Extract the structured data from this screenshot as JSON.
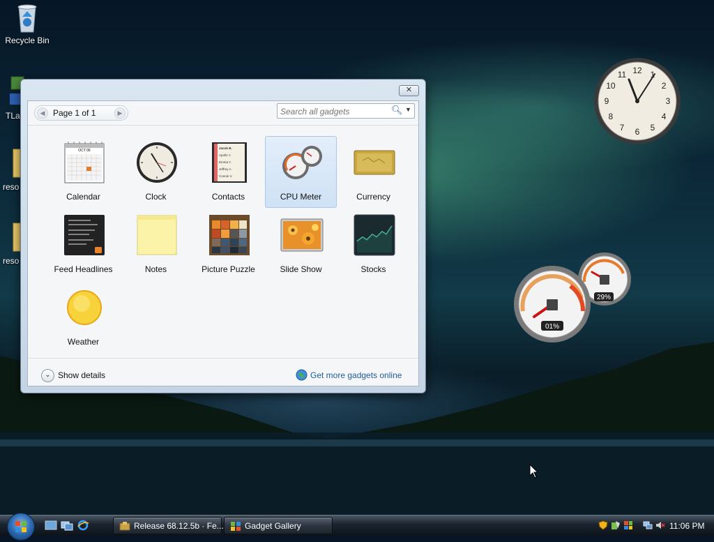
{
  "desktop": {
    "icons": [
      {
        "label": "Recycle Bin"
      },
      {
        "label": "TLa"
      },
      {
        "label": "reso"
      },
      {
        "label": "reso"
      }
    ]
  },
  "gallery": {
    "close_label": "✕",
    "pager": {
      "prev": "◀",
      "text": "Page 1 of 1",
      "next": "▶"
    },
    "search": {
      "placeholder": "Search all gadgets"
    },
    "gadgets": [
      {
        "name": "Calendar"
      },
      {
        "name": "Clock"
      },
      {
        "name": "Contacts"
      },
      {
        "name": "CPU Meter",
        "selected": true
      },
      {
        "name": "Currency"
      },
      {
        "name": "Feed Headlines"
      },
      {
        "name": "Notes"
      },
      {
        "name": "Picture Puzzle"
      },
      {
        "name": "Slide Show"
      },
      {
        "name": "Stocks"
      },
      {
        "name": "Weather"
      }
    ],
    "calendar_month": "OCT 06",
    "contacts_names": [
      "Jacob B.",
      "Apollo Y.",
      "Emma Y.",
      "Jeffrey A.",
      "Connie V."
    ],
    "show_details": "Show details",
    "more_link": "Get more gadgets online"
  },
  "cpu_meter": {
    "cpu_percent": "01%",
    "memory_percent": "29%"
  },
  "clock_numbers": [
    "12",
    "1",
    "2",
    "3",
    "4",
    "5",
    "6",
    "7",
    "8",
    "9",
    "10",
    "11"
  ],
  "taskbar": {
    "buttons": [
      {
        "label": "Release 68.12.5b · Fe..."
      },
      {
        "label": "Gadget Gallery"
      }
    ],
    "time": "11:06 PM"
  },
  "colors": {
    "link": "#1f5d9a",
    "selection": "#cfe1f5",
    "taskbar": "#1c2530"
  }
}
